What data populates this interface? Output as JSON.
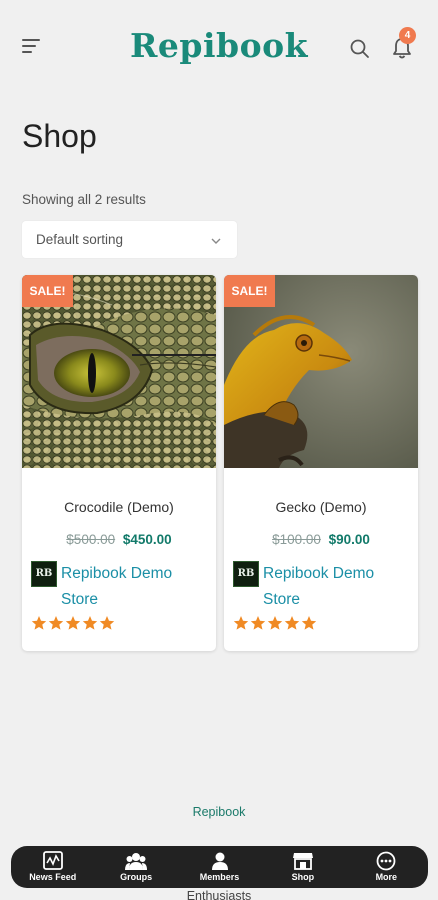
{
  "header": {
    "logo": "Repibook",
    "notification_count": "4"
  },
  "page": {
    "title": "Shop",
    "result_count": "Showing all 2 results",
    "sort": {
      "selected": "Default sorting"
    }
  },
  "products": [
    {
      "badge": "SALE!",
      "name": "Crocodile (Demo)",
      "price_old": "$500.00",
      "price_new": "$450.00",
      "vendor_logo": "RB",
      "vendor": "Repibook Demo Store",
      "rating": 5
    },
    {
      "badge": "SALE!",
      "name": "Gecko (Demo)",
      "price_old": "$100.00",
      "price_new": "$90.00",
      "vendor_logo": "RB",
      "vendor": "Repibook Demo Store",
      "rating": 5
    }
  ],
  "footer": {
    "link": "Repibook",
    "tagline": "Enthusiasts"
  },
  "bottom_nav": [
    {
      "label": "News Feed",
      "icon": "news-feed-icon"
    },
    {
      "label": "Groups",
      "icon": "groups-icon"
    },
    {
      "label": "Members",
      "icon": "members-icon"
    },
    {
      "label": "Shop",
      "icon": "shop-icon"
    },
    {
      "label": "More",
      "icon": "more-icon"
    }
  ],
  "colors": {
    "brand": "#1a8a7a",
    "accent": "#f07a4f",
    "price": "#127a6a",
    "link": "#1b8fa6",
    "star": "#f08a24",
    "nav_bg": "#222222"
  }
}
